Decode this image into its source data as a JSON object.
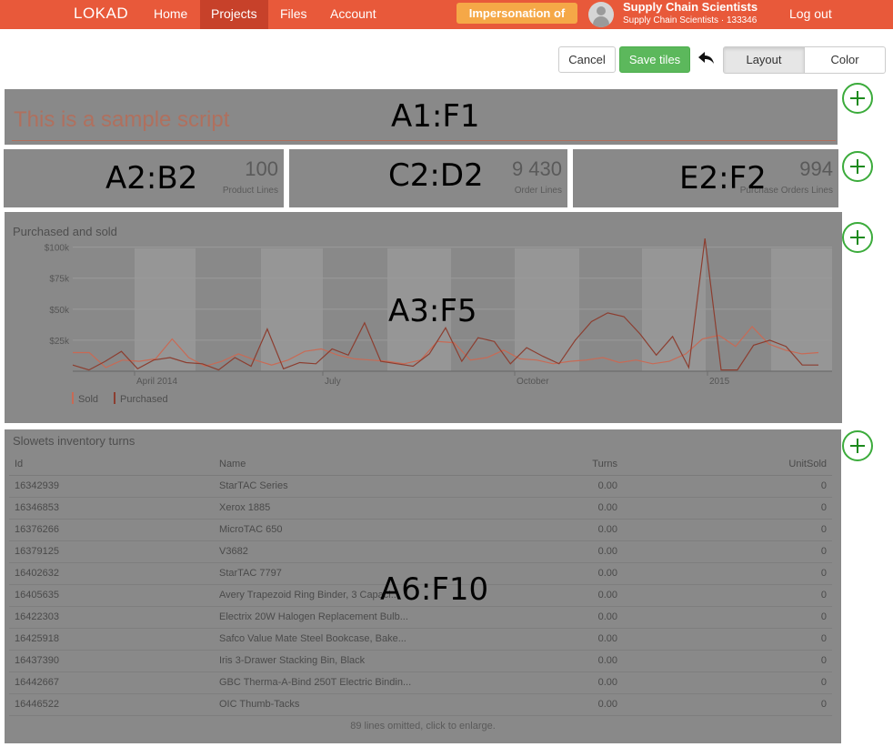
{
  "header": {
    "brand": "LOKAD",
    "nav": [
      "Home",
      "Projects",
      "Files",
      "Account"
    ],
    "impersonation_label": "Impersonation of",
    "account_name": "Supply Chain Scientists",
    "account_sub": "Supply Chain Scientists · 133346",
    "logout_label": "Log out"
  },
  "toolbar": {
    "cancel_label": "Cancel",
    "save_label": "Save tiles",
    "layout_label": "Layout",
    "color_label": "Color"
  },
  "colors": {
    "topbar": "#e8593a",
    "active_nav": "#c7412a",
    "impersonation": "#f5a847",
    "save": "#5cb85c",
    "tile_overlay": "#898989",
    "series_sold": "#c86a55",
    "series_purchased": "#8c3e30"
  },
  "tiles": {
    "script": {
      "range": "A1:F1",
      "text": "This is a sample script"
    },
    "kpi1": {
      "range": "A2:B2",
      "value": "100",
      "caption": "Product Lines"
    },
    "kpi2": {
      "range": "C2:D2",
      "value": "9 430",
      "caption": "Order Lines"
    },
    "kpi3": {
      "range": "E2:F2",
      "value": "994",
      "caption": "Purchase Orders Lines"
    },
    "chart": {
      "range": "A3:F5"
    },
    "table": {
      "range": "A6:F10"
    }
  },
  "chart_data": {
    "type": "line",
    "title": "Purchased and sold",
    "xlabel": "",
    "ylabel": "",
    "x_ticks": [
      "April 2014",
      "July",
      "October",
      "2015"
    ],
    "y_ticks": [
      "$25k",
      "$50k",
      "$75k",
      "$100k"
    ],
    "ylim": [
      0,
      110000
    ],
    "legend_position": "bottom-left",
    "grid": true,
    "series": [
      {
        "name": "Sold",
        "values": [
          15000,
          15000,
          3000,
          9000,
          8000,
          10000,
          26000,
          11000,
          4000,
          8000,
          14000,
          9000,
          5000,
          9000,
          16000,
          18000,
          13000,
          10000,
          9000,
          8000,
          6000,
          9000,
          24000,
          23000,
          9000,
          11000,
          17000,
          10000,
          9000,
          6000,
          8000,
          9000,
          11000,
          7000,
          9000,
          6000,
          8000,
          14000,
          26000,
          29000,
          20000,
          36000,
          22000,
          17000,
          14000,
          15000
        ]
      },
      {
        "name": "Purchased",
        "values": [
          5000,
          1000,
          8000,
          16000,
          2000,
          9000,
          11000,
          7000,
          6000,
          1000,
          11000,
          4000,
          34000,
          2000,
          7000,
          6000,
          18000,
          13000,
          39000,
          8000,
          6000,
          4000,
          14000,
          35000,
          8000,
          27000,
          24000,
          6000,
          19000,
          12000,
          6000,
          25000,
          40000,
          47000,
          44000,
          30000,
          13000,
          28000,
          3000,
          107000,
          1000,
          1000,
          21000,
          25000,
          20000,
          5000,
          5000
        ]
      }
    ]
  },
  "table": {
    "title": "Slowets inventory turns",
    "columns": [
      "Id",
      "Name",
      "Turns",
      "UnitSold"
    ],
    "rows": [
      [
        "16342939",
        "StarTAC Series",
        "0.00",
        "0"
      ],
      [
        "16346853",
        "Xerox 1885",
        "0.00",
        "0"
      ],
      [
        "16376266",
        "MicroTAC 650",
        "0.00",
        "0"
      ],
      [
        "16379125",
        "V3682",
        "0.00",
        "0"
      ],
      [
        "16402632",
        "StarTAC 7797",
        "0.00",
        "0"
      ],
      [
        "16405635",
        "Avery Trapezoid Ring Binder, 3 Capaci...",
        "0.00",
        "0"
      ],
      [
        "16422303",
        "Electrix 20W Halogen Replacement Bulb...",
        "0.00",
        "0"
      ],
      [
        "16425918",
        "Safco Value Mate Steel Bookcase, Bake...",
        "0.00",
        "0"
      ],
      [
        "16437390",
        "Iris 3-Drawer Stacking Bin, Black",
        "0.00",
        "0"
      ],
      [
        "16442667",
        "GBC Therma-A-Bind 250T Electric Bindin...",
        "0.00",
        "0"
      ],
      [
        "16446522",
        "OIC Thumb-Tacks",
        "0.00",
        "0"
      ]
    ],
    "footer": "89 lines omitted, click to enlarge."
  }
}
